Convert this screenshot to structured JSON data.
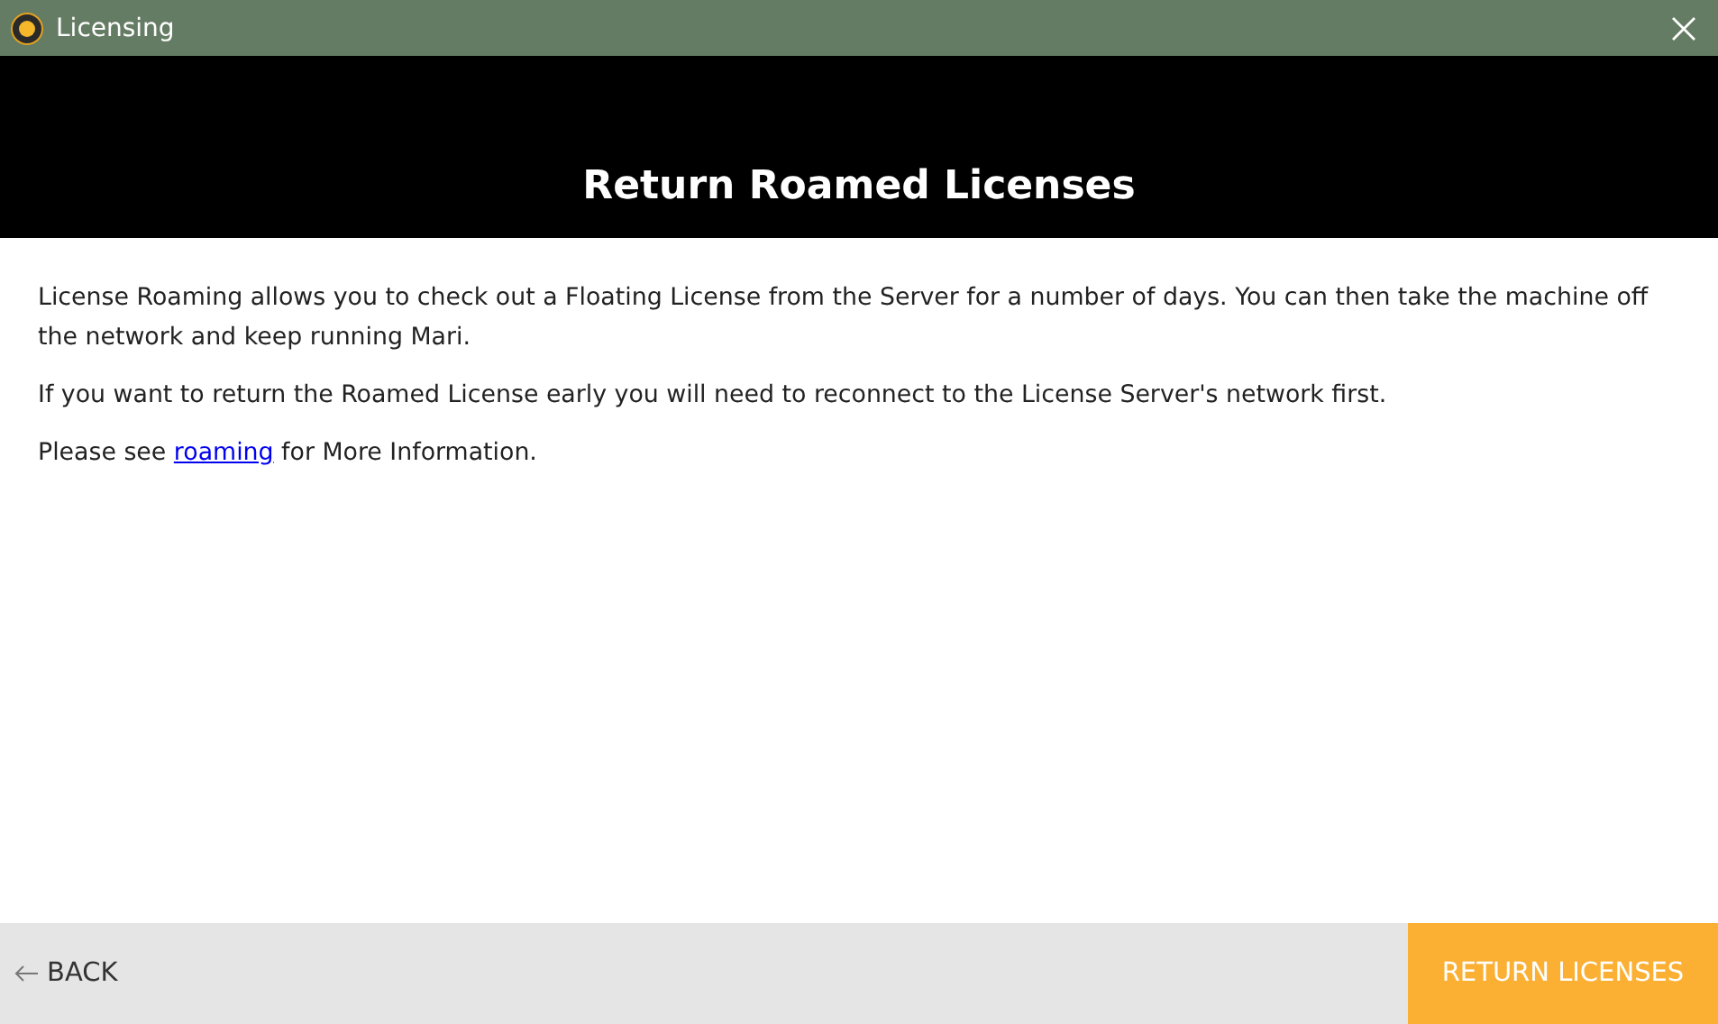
{
  "window": {
    "title": "Licensing"
  },
  "header": {
    "title": "Return Roamed Licenses"
  },
  "paragraphs": [
    {
      "kind": "text",
      "text": "License Roaming allows you to check out a Floating License from the Server for a number of days. You can then take the machine off the network and keep running Mari."
    },
    {
      "kind": "text",
      "text": "If you want to return the Roamed License early you will need to reconnect to the License Server's network first."
    },
    {
      "kind": "link",
      "before": "Please see ",
      "link": "roaming",
      "after": " for More Information."
    }
  ],
  "footer": {
    "back": "BACK",
    "primary": "RETURN LICENSES"
  }
}
